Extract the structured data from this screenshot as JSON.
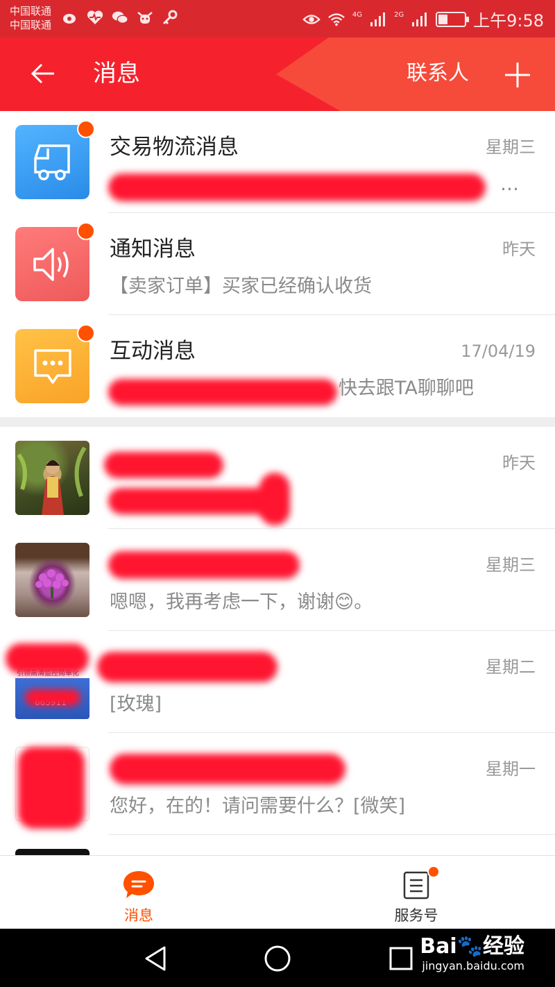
{
  "status_bar": {
    "carrier_1": "中国联通",
    "carrier_2": "中国联通",
    "network_1": "4G",
    "network_2": "2G",
    "time": "上午9:58",
    "battery_level": 0.35,
    "icons": [
      "weibo-icon",
      "heart-rate-icon",
      "wechat-icon",
      "cow-icon",
      "key-icon",
      "eye-icon",
      "wifi-icon",
      "signal-icon",
      "battery-icon"
    ]
  },
  "header": {
    "back_icon": "arrow-left-icon",
    "title": "消息",
    "contacts_label": "联系人",
    "add_icon": "plus-icon",
    "bg_color": "#f5222d",
    "wedge_color": "#f64a3a"
  },
  "system_messages": [
    {
      "name": "交易物流消息",
      "time": "星期三",
      "preview": "…",
      "icon": "truck-icon",
      "color": "#3d9cf2",
      "unread": true,
      "redacted": true
    },
    {
      "name": "通知消息",
      "time": "昨天",
      "preview": "【卖家订单】买家已经确认收货",
      "icon": "speaker-icon",
      "color": "#f56a6a",
      "unread": true,
      "redacted": false
    },
    {
      "name": "互动消息",
      "time": "17/04/19",
      "preview": "快去跟TA聊聊吧",
      "icon": "chat-bubble-icon",
      "color": "#fbb03b",
      "unread": true,
      "redacted": true
    }
  ],
  "chats": [
    {
      "name": "",
      "time": "昨天",
      "preview": "",
      "avatar": "girl-photo-avatar"
    },
    {
      "name": "",
      "time": "星期三",
      "preview": "嗯嗯，我再考虑一下，谢谢😊。",
      "avatar": "flower-photo-avatar"
    },
    {
      "name": "",
      "time": "星期二",
      "preview": "[玫瑰]",
      "avatar": "shop-banner-avatar",
      "avatar_text_1": "引领高清监控简单化",
      "avatar_text_2": "665911"
    },
    {
      "name": "",
      "time": "星期一",
      "preview": "您好，在的！请问需要什么？[微笑]",
      "avatar": "shop-logo-avatar"
    }
  ],
  "tabbar": {
    "tabs": [
      {
        "label": "消息",
        "icon": "message-bubble-icon",
        "active": true,
        "color": "#ff5000"
      },
      {
        "label": "服务号",
        "icon": "clipboard-icon",
        "active": false,
        "badge": true,
        "color": "#333333"
      }
    ]
  },
  "navbar": {
    "buttons": [
      "back-triangle-icon",
      "home-circle-icon",
      "recents-square-icon"
    ],
    "watermark_brand": "Bai🐾经验",
    "watermark_url": "jingyan.baidu.com"
  }
}
